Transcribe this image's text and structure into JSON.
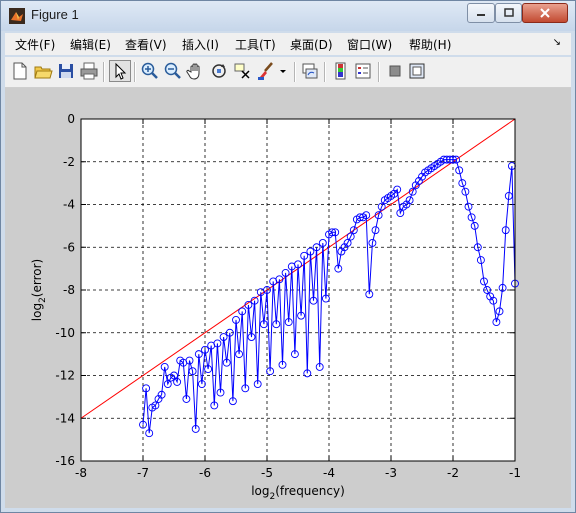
{
  "window": {
    "title": "Figure 1"
  },
  "menu": [
    "文件(F)",
    "编辑(E)",
    "查看(V)",
    "插入(I)",
    "工具(T)",
    "桌面(D)",
    "窗口(W)",
    "帮助(H)"
  ],
  "toolbar": [
    "new-figure-icon",
    "open-file-icon",
    "save-icon",
    "print-icon",
    "edit-plot-arrow-icon",
    "zoom-in-icon",
    "zoom-out-icon",
    "pan-hand-icon",
    "rotate-3d-icon",
    "data-cursor-icon",
    "brush-icon",
    "link-plot-icon",
    "colorbar-icon",
    "legend-icon",
    "hide-plot-tools-icon",
    "show-plot-tools-icon"
  ],
  "chart_data": {
    "type": "line",
    "xlabel": {
      "main": "log",
      "sub": "2",
      "rest": "(frequency)"
    },
    "ylabel": {
      "main": "log",
      "sub": "2",
      "rest": "(error)"
    },
    "xlim": [
      -8,
      -1
    ],
    "ylim": [
      -16,
      0
    ],
    "xticks": [
      "-8",
      "-7",
      "-6",
      "-5",
      "-4",
      "-3",
      "-2",
      "-1"
    ],
    "yticks": [
      "0",
      "-2",
      "-4",
      "-6",
      "-8",
      "-10",
      "-12",
      "-14",
      "-16"
    ],
    "grid": true,
    "series": [
      {
        "color": "#ff0000",
        "marker": "none",
        "x": [
          -8,
          -1
        ],
        "y": [
          -14,
          0
        ]
      },
      {
        "color": "#0000ff",
        "marker": "circle",
        "x": [
          -7.0,
          -6.95,
          -6.9,
          -6.85,
          -6.8,
          -6.75,
          -6.7,
          -6.65,
          -6.6,
          -6.55,
          -6.5,
          -6.45,
          -6.4,
          -6.35,
          -6.3,
          -6.25,
          -6.2,
          -6.15,
          -6.1,
          -6.05,
          -6.0,
          -5.95,
          -5.9,
          -5.85,
          -5.8,
          -5.75,
          -5.7,
          -5.65,
          -5.6,
          -5.55,
          -5.5,
          -5.45,
          -5.4,
          -5.35,
          -5.3,
          -5.25,
          -5.2,
          -5.15,
          -5.1,
          -5.05,
          -5.0,
          -4.95,
          -4.9,
          -4.85,
          -4.8,
          -4.75,
          -4.7,
          -4.65,
          -4.6,
          -4.55,
          -4.5,
          -4.45,
          -4.4,
          -4.35,
          -4.3,
          -4.25,
          -4.2,
          -4.15,
          -4.1,
          -4.05,
          -4.0,
          -3.95,
          -3.9,
          -3.85,
          -3.8,
          -3.75,
          -3.7,
          -3.65,
          -3.6,
          -3.55,
          -3.5,
          -3.45,
          -3.4,
          -3.35,
          -3.3,
          -3.25,
          -3.2,
          -3.15,
          -3.1,
          -3.05,
          -3.0,
          -2.95,
          -2.9,
          -2.85,
          -2.8,
          -2.75,
          -2.7,
          -2.65,
          -2.6,
          -2.55,
          -2.5,
          -2.45,
          -2.4,
          -2.35,
          -2.3,
          -2.25,
          -2.2,
          -2.15,
          -2.1,
          -2.05,
          -2.0,
          -1.95,
          -1.9,
          -1.85,
          -1.8,
          -1.75,
          -1.7,
          -1.65,
          -1.6,
          -1.55,
          -1.5,
          -1.45,
          -1.4,
          -1.35,
          -1.3,
          -1.25,
          -1.2,
          -1.15,
          -1.1,
          -1.05,
          -1.0
        ],
        "y": [
          -14.3,
          -12.6,
          -14.7,
          -13.5,
          -13.4,
          -13.1,
          -12.9,
          -11.6,
          -12.4,
          -12.1,
          -12.0,
          -12.3,
          -11.3,
          -11.4,
          -13.1,
          -11.3,
          -11.8,
          -14.5,
          -11.0,
          -12.4,
          -10.8,
          -11.7,
          -10.6,
          -13.4,
          -10.5,
          -12.8,
          -10.2,
          -11.4,
          -10.0,
          -13.2,
          -9.4,
          -11.0,
          -9.0,
          -12.6,
          -8.7,
          -10.2,
          -8.5,
          -12.4,
          -8.1,
          -9.6,
          -8.0,
          -11.8,
          -7.6,
          -9.6,
          -7.5,
          -11.5,
          -7.2,
          -9.5,
          -6.9,
          -11.0,
          -6.8,
          -9.2,
          -6.4,
          -11.9,
          -6.2,
          -8.5,
          -6.0,
          -11.6,
          -5.8,
          -8.4,
          -5.4,
          -5.3,
          -5.3,
          -7.0,
          -6.2,
          -6.0,
          -5.8,
          -5.5,
          -5.2,
          -4.7,
          -4.6,
          -4.6,
          -4.5,
          -8.2,
          -5.8,
          -5.2,
          -4.5,
          -4.1,
          -3.8,
          -3.7,
          -3.6,
          -3.5,
          -3.3,
          -4.4,
          -4.1,
          -4.0,
          -3.8,
          -3.4,
          -3.1,
          -2.9,
          -2.7,
          -2.5,
          -2.4,
          -2.3,
          -2.2,
          -2.1,
          -2.0,
          -1.9,
          -1.9,
          -1.9,
          -1.9,
          -1.9,
          -2.4,
          -3.0,
          -3.4,
          -4.1,
          -4.6,
          -5.0,
          -6.0,
          -6.6,
          -7.6,
          -8.0,
          -8.3,
          -8.5,
          -9.5,
          -9.0,
          -7.9,
          -5.2,
          -3.6,
          -2.2,
          -7.7
        ]
      }
    ]
  }
}
